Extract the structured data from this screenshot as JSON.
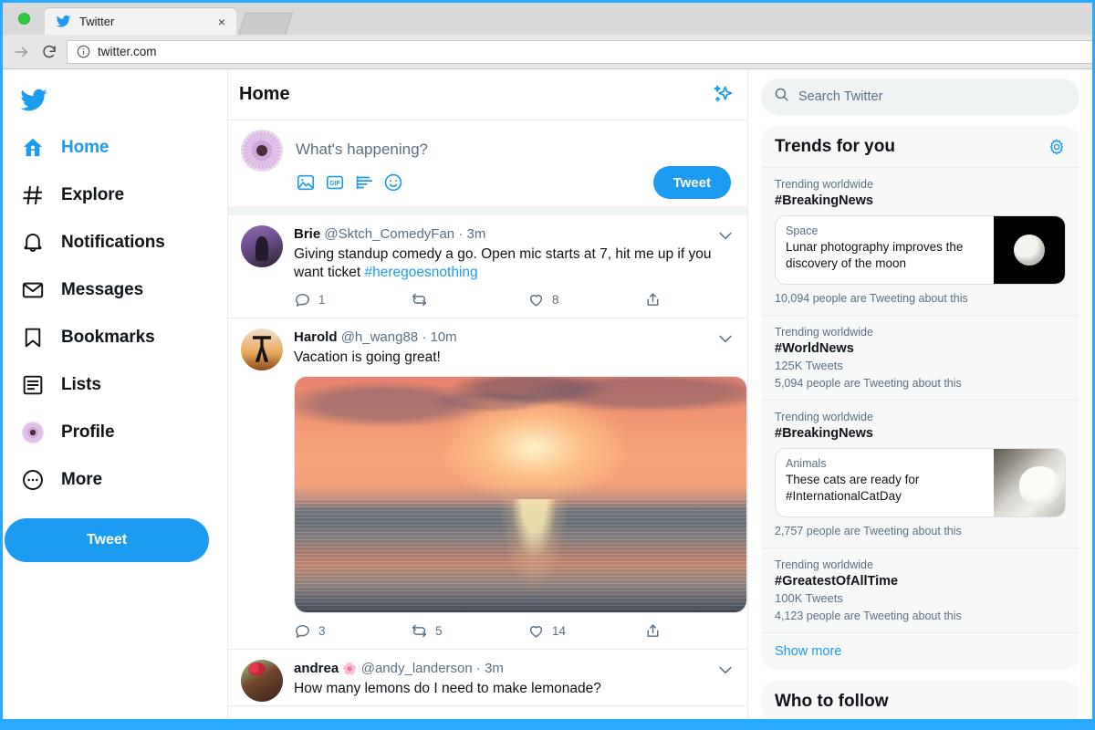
{
  "browser": {
    "tab_title": "Twitter",
    "tab_close_label": "×",
    "url": "twitter.com"
  },
  "sidebar": {
    "logo": "twitter-bird-logo",
    "items": [
      {
        "label": "Home",
        "icon": "home-icon",
        "active": true
      },
      {
        "label": "Explore",
        "icon": "hashtag-icon",
        "active": false
      },
      {
        "label": "Notifications",
        "icon": "bell-icon",
        "active": false
      },
      {
        "label": "Messages",
        "icon": "envelope-icon",
        "active": false
      },
      {
        "label": "Bookmarks",
        "icon": "bookmark-icon",
        "active": false
      },
      {
        "label": "Lists",
        "icon": "list-icon",
        "active": false
      },
      {
        "label": "Profile",
        "icon": "profile-avatar-icon",
        "active": false
      },
      {
        "label": "More",
        "icon": "more-circle-icon",
        "active": false
      }
    ],
    "tweet_button": "Tweet"
  },
  "feed": {
    "title": "Home",
    "sparkle_icon": "sparkle-icon",
    "composer": {
      "placeholder": "What's happening?",
      "tweet_button": "Tweet",
      "icons": [
        "image-icon",
        "gif-icon",
        "poll-icon",
        "emoji-icon"
      ]
    },
    "tweets": [
      {
        "name": "Brie",
        "handle": "@Sktch_ComedyFan",
        "dot": "·",
        "time": "3m",
        "text": "Giving standup comedy a go. Open mic starts at 7, hit me up if you want ticket ",
        "hashtag": "#heregoesnothing",
        "replies": "1",
        "retweets": "",
        "likes": "8",
        "has_media": false
      },
      {
        "name": "Harold",
        "handle": "@h_wang88",
        "dot": "·",
        "time": "10m",
        "text": "Vacation is going great!",
        "hashtag": "",
        "replies": "3",
        "retweets": "5",
        "likes": "14",
        "has_media": true,
        "media_alt": "sunset-over-ocean-photo"
      },
      {
        "name": "andrea",
        "name_emoji": "🌸",
        "handle": "@andy_landerson",
        "dot": "·",
        "time": "3m",
        "text": "How many lemons do I need to make lemonade?",
        "hashtag": "",
        "replies": "",
        "retweets": "",
        "likes": "",
        "has_media": false
      }
    ]
  },
  "rightbar": {
    "search_placeholder": "Search Twitter",
    "trends_panel": {
      "title": "Trends for you",
      "settings_icon": "gear-icon",
      "trends": [
        {
          "category": "Trending worldwide",
          "tag": "#BreakingNews",
          "tweet_count": "",
          "card": {
            "category": "Space",
            "title": "Lunar photography improves the discovery of the moon",
            "image": "moon-photo"
          },
          "people": "10,094 people are Tweeting about this"
        },
        {
          "category": "Trending worldwide",
          "tag": "#WorldNews",
          "tweet_count": "125K Tweets",
          "card": null,
          "people": "5,094 people are Tweeting about this"
        },
        {
          "category": "Trending worldwide",
          "tag": "#BreakingNews",
          "tweet_count": "",
          "card": {
            "category": "Animals",
            "title": "These cats are ready for #InternationalCatDay",
            "image": "cats-photo"
          },
          "people": "2,757 people are Tweeting about this"
        },
        {
          "category": "Trending worldwide",
          "tag": "#GreatestOfAllTime",
          "tweet_count": "100K Tweets",
          "card": null,
          "people": "4,123 people are Tweeting about this"
        }
      ],
      "show_more": "Show more"
    },
    "who_to_follow": {
      "title": "Who to follow"
    }
  },
  "colors": {
    "twitter_blue": "#1d9bf0",
    "chrome_blue": "#29a9ff",
    "text_primary": "#0f1419",
    "text_secondary": "#5b7083",
    "panel_bg": "#f7f9f9",
    "divider": "#e6ecf0"
  }
}
